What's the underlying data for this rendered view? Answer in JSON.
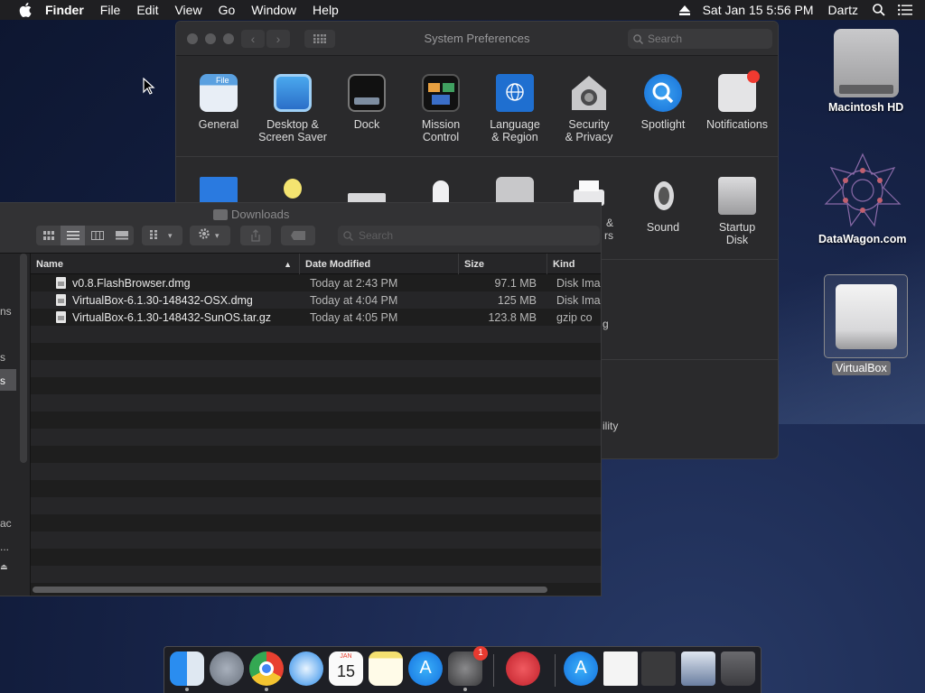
{
  "menubar": {
    "app": "Finder",
    "items": [
      "File",
      "Edit",
      "View",
      "Go",
      "Window",
      "Help"
    ],
    "datetime": "Sat Jan 15  5:56 PM",
    "user": "Dartz"
  },
  "sysprefs": {
    "title": "System Preferences",
    "search_placeholder": "Search",
    "row1": [
      {
        "label": "General",
        "icon": "general-icon"
      },
      {
        "label": "Desktop &\nScreen Saver",
        "icon": "desktop-icon"
      },
      {
        "label": "Dock",
        "icon": "dock-icon"
      },
      {
        "label": "Mission\nControl",
        "icon": "mission-control-icon"
      },
      {
        "label": "Language\n& Region",
        "icon": "globe-flag-icon"
      },
      {
        "label": "Security\n& Privacy",
        "icon": "security-house-icon"
      },
      {
        "label": "Spotlight",
        "icon": "spotlight-icon"
      },
      {
        "label": "Notifications",
        "icon": "notifications-icon"
      }
    ],
    "row2_visible": [
      {
        "label": "Sound",
        "icon": "speaker-icon"
      },
      {
        "label": "Startup\nDisk",
        "icon": "startup-disk-icon"
      }
    ],
    "partial_text": {
      "row2_partial": "&",
      "row2_partial2": "rs",
      "row3_partial": "g",
      "row4_partial": "ility"
    }
  },
  "finder": {
    "title": "Downloads",
    "search_placeholder": "Search",
    "columns": {
      "name": "Name",
      "date": "Date Modified",
      "size": "Size",
      "kind": "Kind"
    },
    "files": [
      {
        "name": "v0.8.FlashBrowser.dmg",
        "date": "Today at 2:43 PM",
        "size": "97.1 MB",
        "kind": "Disk Ima"
      },
      {
        "name": "VirtualBox-6.1.30-148432-OSX.dmg",
        "date": "Today at 4:04 PM",
        "size": "125 MB",
        "kind": "Disk Ima"
      },
      {
        "name": "VirtualBox-6.1.30-148432-SunOS.tar.gz",
        "date": "Today at 4:05 PM",
        "size": "123.8 MB",
        "kind": "gzip co"
      }
    ],
    "sidebar_fragments": [
      "ns",
      "s",
      "s",
      "ac",
      "..."
    ]
  },
  "desktop": {
    "icons": [
      {
        "label": "Macintosh HD"
      },
      {
        "label": "DataWagon.com"
      },
      {
        "label": "VirtualBox"
      }
    ]
  },
  "dock": {
    "badge": "1",
    "calendar_month": "JAN",
    "calendar_day": "15"
  }
}
